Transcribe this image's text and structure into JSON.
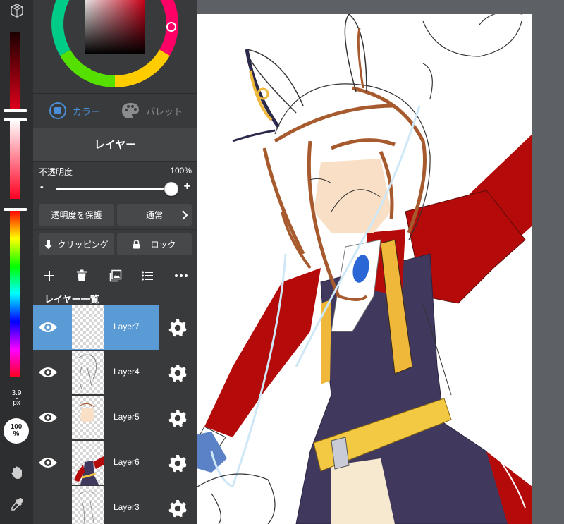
{
  "toolbar": {
    "brush_size_value": "3.9",
    "brush_size_unit": "px",
    "brush_opacity_value": "100",
    "brush_opacity_unit": "%",
    "icons": [
      "cube-icon",
      "hand-icon",
      "eyedropper-icon"
    ]
  },
  "color_panel": {
    "tabs": [
      {
        "label": "カラー",
        "active": true
      },
      {
        "label": "パレット",
        "active": false
      }
    ],
    "active_color": "#4a90d9"
  },
  "layer_panel": {
    "title": "レイヤー",
    "opacity_label": "不透明度",
    "opacity_value": "100%",
    "opacity_fraction": 1.0,
    "opacity_minus": "-",
    "opacity_plus": "+",
    "protect_alpha_label": "透明度を保護",
    "blend_mode_label": "通常",
    "clipping_label": "クリッピング",
    "lock_label": "ロック",
    "list_title": "レイヤー一覧",
    "layers": [
      {
        "name": "Layer7",
        "selected": true,
        "visible": true
      },
      {
        "name": "Layer4",
        "selected": false,
        "visible": true
      },
      {
        "name": "Layer5",
        "selected": false,
        "visible": true
      },
      {
        "name": "Layer6",
        "selected": false,
        "visible": true
      },
      {
        "name": "Layer3",
        "selected": false,
        "visible": true
      }
    ]
  },
  "colors": {
    "selection": "#5b9bd5",
    "panel_bg": "#393a3c",
    "strip_bg": "#2d2e30",
    "workspace_bg": "#5d6064"
  }
}
